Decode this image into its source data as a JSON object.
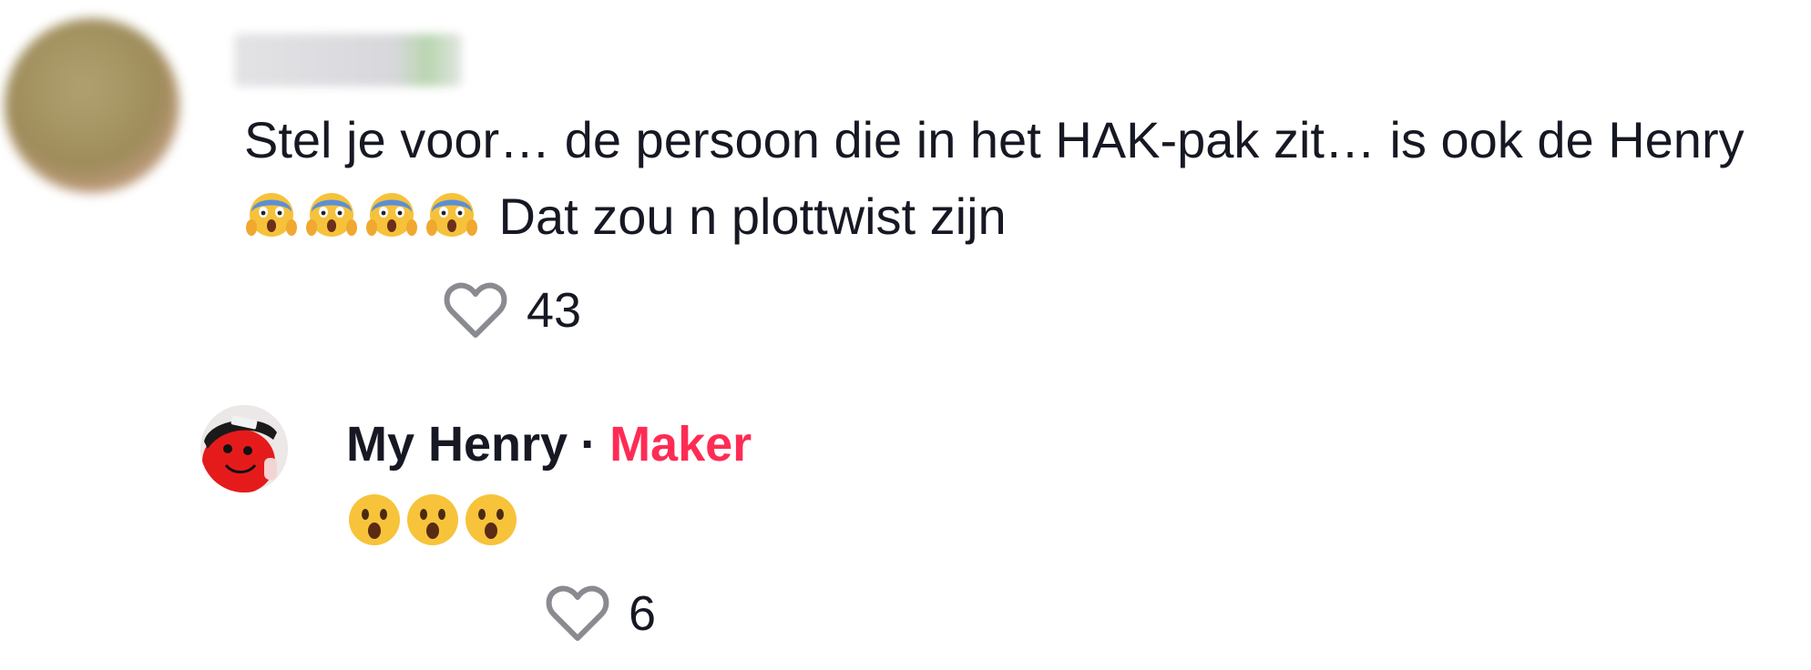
{
  "comment": {
    "text": "Stel je voor… de persoon die in het HAK-pak zit… is ook de Henry",
    "text_after_emojis": " Dat zou n plottwist zijn",
    "emojis": [
      "face-screaming-in-fear",
      "face-screaming-in-fear",
      "face-screaming-in-fear",
      "face-screaming-in-fear"
    ],
    "likes": "43"
  },
  "reply": {
    "author": "My Henry",
    "separator": "·",
    "badge": "Maker",
    "emojis": [
      "face-with-open-mouth",
      "face-with-open-mouth",
      "face-with-open-mouth"
    ],
    "likes": "6"
  },
  "colors": {
    "text": "#161823",
    "maker_badge": "#fe2c55",
    "heart_outline": "#8a8b91"
  }
}
